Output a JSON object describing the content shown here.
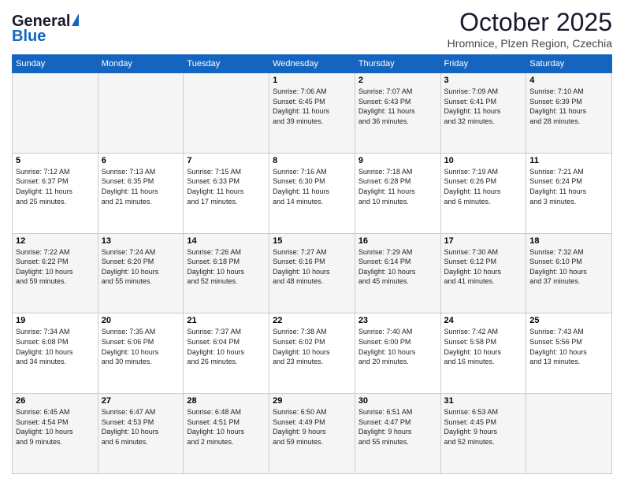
{
  "header": {
    "logo_general": "General",
    "logo_blue": "Blue",
    "month": "October 2025",
    "location": "Hromnice, Plzen Region, Czechia"
  },
  "weekdays": [
    "Sunday",
    "Monday",
    "Tuesday",
    "Wednesday",
    "Thursday",
    "Friday",
    "Saturday"
  ],
  "weeks": [
    [
      {
        "day": "",
        "info": ""
      },
      {
        "day": "",
        "info": ""
      },
      {
        "day": "",
        "info": ""
      },
      {
        "day": "1",
        "info": "Sunrise: 7:06 AM\nSunset: 6:45 PM\nDaylight: 11 hours\nand 39 minutes."
      },
      {
        "day": "2",
        "info": "Sunrise: 7:07 AM\nSunset: 6:43 PM\nDaylight: 11 hours\nand 36 minutes."
      },
      {
        "day": "3",
        "info": "Sunrise: 7:09 AM\nSunset: 6:41 PM\nDaylight: 11 hours\nand 32 minutes."
      },
      {
        "day": "4",
        "info": "Sunrise: 7:10 AM\nSunset: 6:39 PM\nDaylight: 11 hours\nand 28 minutes."
      }
    ],
    [
      {
        "day": "5",
        "info": "Sunrise: 7:12 AM\nSunset: 6:37 PM\nDaylight: 11 hours\nand 25 minutes."
      },
      {
        "day": "6",
        "info": "Sunrise: 7:13 AM\nSunset: 6:35 PM\nDaylight: 11 hours\nand 21 minutes."
      },
      {
        "day": "7",
        "info": "Sunrise: 7:15 AM\nSunset: 6:33 PM\nDaylight: 11 hours\nand 17 minutes."
      },
      {
        "day": "8",
        "info": "Sunrise: 7:16 AM\nSunset: 6:30 PM\nDaylight: 11 hours\nand 14 minutes."
      },
      {
        "day": "9",
        "info": "Sunrise: 7:18 AM\nSunset: 6:28 PM\nDaylight: 11 hours\nand 10 minutes."
      },
      {
        "day": "10",
        "info": "Sunrise: 7:19 AM\nSunset: 6:26 PM\nDaylight: 11 hours\nand 6 minutes."
      },
      {
        "day": "11",
        "info": "Sunrise: 7:21 AM\nSunset: 6:24 PM\nDaylight: 11 hours\nand 3 minutes."
      }
    ],
    [
      {
        "day": "12",
        "info": "Sunrise: 7:22 AM\nSunset: 6:22 PM\nDaylight: 10 hours\nand 59 minutes."
      },
      {
        "day": "13",
        "info": "Sunrise: 7:24 AM\nSunset: 6:20 PM\nDaylight: 10 hours\nand 55 minutes."
      },
      {
        "day": "14",
        "info": "Sunrise: 7:26 AM\nSunset: 6:18 PM\nDaylight: 10 hours\nand 52 minutes."
      },
      {
        "day": "15",
        "info": "Sunrise: 7:27 AM\nSunset: 6:16 PM\nDaylight: 10 hours\nand 48 minutes."
      },
      {
        "day": "16",
        "info": "Sunrise: 7:29 AM\nSunset: 6:14 PM\nDaylight: 10 hours\nand 45 minutes."
      },
      {
        "day": "17",
        "info": "Sunrise: 7:30 AM\nSunset: 6:12 PM\nDaylight: 10 hours\nand 41 minutes."
      },
      {
        "day": "18",
        "info": "Sunrise: 7:32 AM\nSunset: 6:10 PM\nDaylight: 10 hours\nand 37 minutes."
      }
    ],
    [
      {
        "day": "19",
        "info": "Sunrise: 7:34 AM\nSunset: 6:08 PM\nDaylight: 10 hours\nand 34 minutes."
      },
      {
        "day": "20",
        "info": "Sunrise: 7:35 AM\nSunset: 6:06 PM\nDaylight: 10 hours\nand 30 minutes."
      },
      {
        "day": "21",
        "info": "Sunrise: 7:37 AM\nSunset: 6:04 PM\nDaylight: 10 hours\nand 26 minutes."
      },
      {
        "day": "22",
        "info": "Sunrise: 7:38 AM\nSunset: 6:02 PM\nDaylight: 10 hours\nand 23 minutes."
      },
      {
        "day": "23",
        "info": "Sunrise: 7:40 AM\nSunset: 6:00 PM\nDaylight: 10 hours\nand 20 minutes."
      },
      {
        "day": "24",
        "info": "Sunrise: 7:42 AM\nSunset: 5:58 PM\nDaylight: 10 hours\nand 16 minutes."
      },
      {
        "day": "25",
        "info": "Sunrise: 7:43 AM\nSunset: 5:56 PM\nDaylight: 10 hours\nand 13 minutes."
      }
    ],
    [
      {
        "day": "26",
        "info": "Sunrise: 6:45 AM\nSunset: 4:54 PM\nDaylight: 10 hours\nand 9 minutes."
      },
      {
        "day": "27",
        "info": "Sunrise: 6:47 AM\nSunset: 4:53 PM\nDaylight: 10 hours\nand 6 minutes."
      },
      {
        "day": "28",
        "info": "Sunrise: 6:48 AM\nSunset: 4:51 PM\nDaylight: 10 hours\nand 2 minutes."
      },
      {
        "day": "29",
        "info": "Sunrise: 6:50 AM\nSunset: 4:49 PM\nDaylight: 9 hours\nand 59 minutes."
      },
      {
        "day": "30",
        "info": "Sunrise: 6:51 AM\nSunset: 4:47 PM\nDaylight: 9 hours\nand 55 minutes."
      },
      {
        "day": "31",
        "info": "Sunrise: 6:53 AM\nSunset: 4:45 PM\nDaylight: 9 hours\nand 52 minutes."
      },
      {
        "day": "",
        "info": ""
      }
    ]
  ]
}
